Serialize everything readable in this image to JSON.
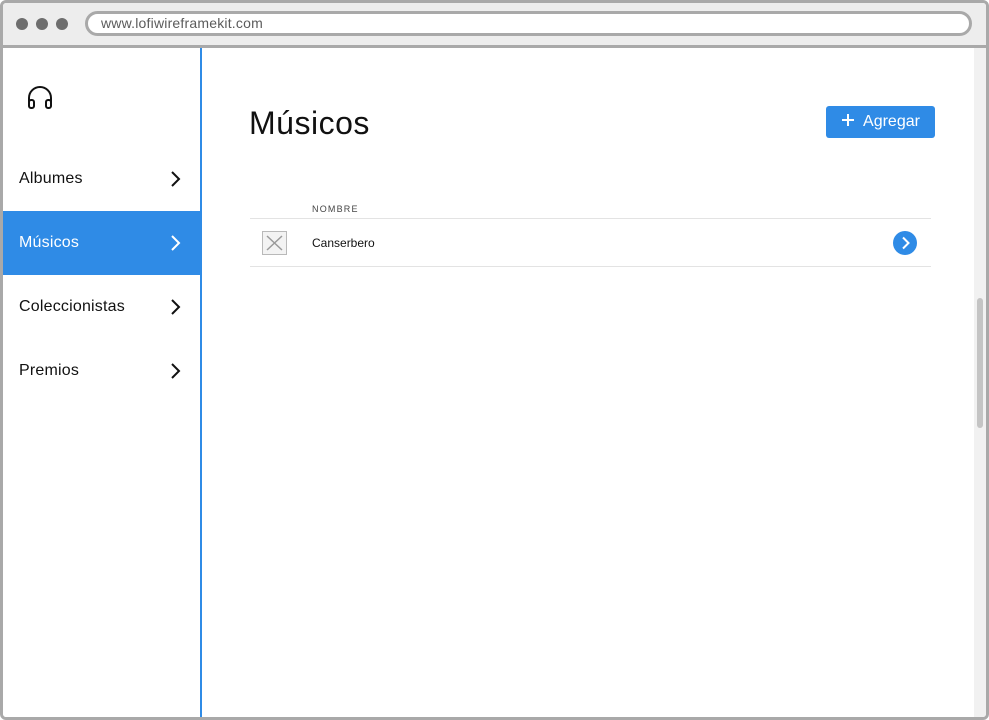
{
  "browser": {
    "url": "www.lofiwireframekit.com"
  },
  "sidebar": {
    "logo_icon": "headphones-icon",
    "items": [
      {
        "label": "Albumes",
        "active": false
      },
      {
        "label": "Músicos",
        "active": true
      },
      {
        "label": "Coleccionistas",
        "active": false
      },
      {
        "label": "Premios",
        "active": false
      }
    ]
  },
  "main": {
    "title": "Músicos",
    "add_button_label": "Agregar",
    "table": {
      "columns": [
        "NOMBRE"
      ],
      "rows": [
        {
          "name": "Canserbero"
        }
      ]
    }
  },
  "colors": {
    "accent": "#2f8be6",
    "chrome_border": "#a9a9a9"
  }
}
